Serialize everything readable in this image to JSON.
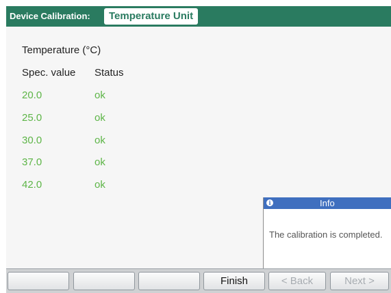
{
  "title_bar": {
    "prefix": "Device Calibration:",
    "tab_label": "Temperature Unit"
  },
  "heading": "Temperature (°C)",
  "table": {
    "columns": [
      "Spec. value",
      "Status"
    ],
    "rows": [
      {
        "value": "20.0",
        "status": "ok"
      },
      {
        "value": "25.0",
        "status": "ok"
      },
      {
        "value": "30.0",
        "status": "ok"
      },
      {
        "value": "37.0",
        "status": "ok"
      },
      {
        "value": "42.0",
        "status": "ok"
      }
    ]
  },
  "info": {
    "icon": "info-icon",
    "title": "Info",
    "message": "The calibration is completed."
  },
  "buttons": [
    {
      "label": "",
      "enabled": false
    },
    {
      "label": "",
      "enabled": false
    },
    {
      "label": "",
      "enabled": false
    },
    {
      "label": "Finish",
      "enabled": true
    },
    {
      "label": "< Back",
      "enabled": false
    },
    {
      "label": "Next >",
      "enabled": false
    }
  ],
  "colors": {
    "title_bar": "#2a7b60",
    "status_ok": "#5db547",
    "info_header": "#3f6fbf"
  }
}
